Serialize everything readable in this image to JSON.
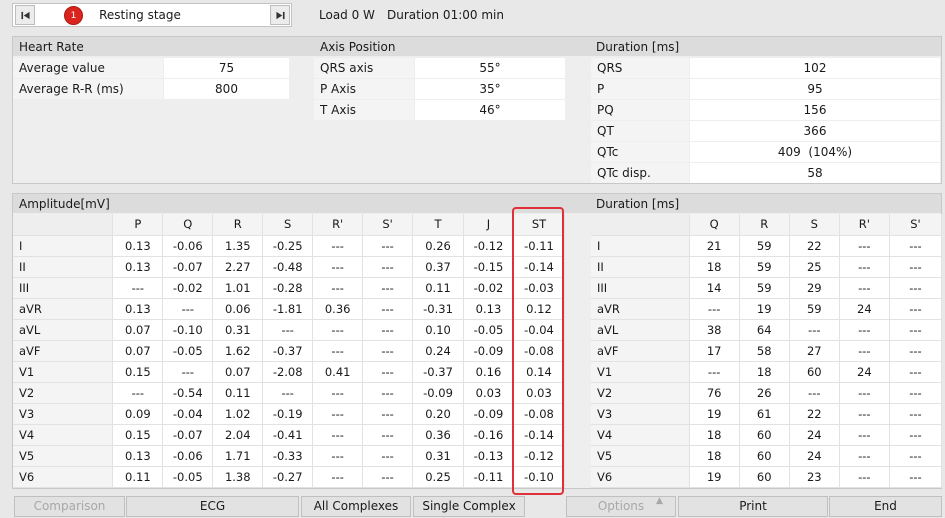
{
  "toolbar": {
    "stage_number": "1",
    "stage_name": "Resting stage",
    "load": "Load 0 W",
    "duration": "Duration 01:00 min"
  },
  "heart_rate": {
    "title": "Heart Rate",
    "rows": [
      {
        "label": "Average value",
        "value": "75"
      },
      {
        "label": "Average R-R (ms)",
        "value": "800"
      }
    ]
  },
  "axis_position": {
    "title": "Axis Position",
    "rows": [
      {
        "label": "QRS axis",
        "value": "55°"
      },
      {
        "label": "P Axis",
        "value": "35°"
      },
      {
        "label": "T Axis",
        "value": "46°"
      }
    ]
  },
  "duration_top": {
    "title": "Duration [ms]",
    "rows": [
      {
        "label": "QRS",
        "value": "102"
      },
      {
        "label": "P",
        "value": "95"
      },
      {
        "label": "PQ",
        "value": "156"
      },
      {
        "label": "QT",
        "value": "366"
      },
      {
        "label": "QTc",
        "value": "409  (104%)"
      },
      {
        "label": "QTc disp.",
        "value": "58"
      }
    ]
  },
  "amplitude": {
    "title": "Amplitude[mV]",
    "columns": [
      "P",
      "Q",
      "R",
      "S",
      "R'",
      "S'",
      "T",
      "J",
      "ST"
    ],
    "rows": [
      {
        "lead": "I",
        "values": [
          "0.13",
          "-0.06",
          "1.35",
          "-0.25",
          "---",
          "---",
          "0.26",
          "-0.12",
          "-0.11"
        ]
      },
      {
        "lead": "II",
        "values": [
          "0.13",
          "-0.07",
          "2.27",
          "-0.48",
          "---",
          "---",
          "0.37",
          "-0.15",
          "-0.14"
        ]
      },
      {
        "lead": "III",
        "values": [
          "---",
          "-0.02",
          "1.01",
          "-0.28",
          "---",
          "---",
          "0.11",
          "-0.02",
          "-0.03"
        ]
      },
      {
        "lead": "aVR",
        "values": [
          "0.13",
          "---",
          "0.06",
          "-1.81",
          "0.36",
          "---",
          "-0.31",
          "0.13",
          "0.12"
        ]
      },
      {
        "lead": "aVL",
        "values": [
          "0.07",
          "-0.10",
          "0.31",
          "---",
          "---",
          "---",
          "0.10",
          "-0.05",
          "-0.04"
        ]
      },
      {
        "lead": "aVF",
        "values": [
          "0.07",
          "-0.05",
          "1.62",
          "-0.37",
          "---",
          "---",
          "0.24",
          "-0.09",
          "-0.08"
        ]
      },
      {
        "lead": "V1",
        "values": [
          "0.15",
          "---",
          "0.07",
          "-2.08",
          "0.41",
          "---",
          "-0.37",
          "0.16",
          "0.14"
        ]
      },
      {
        "lead": "V2",
        "values": [
          "---",
          "-0.54",
          "0.11",
          "---",
          "---",
          "---",
          "-0.09",
          "0.03",
          "0.03"
        ]
      },
      {
        "lead": "V3",
        "values": [
          "0.09",
          "-0.04",
          "1.02",
          "-0.19",
          "---",
          "---",
          "0.20",
          "-0.09",
          "-0.08"
        ]
      },
      {
        "lead": "V4",
        "values": [
          "0.15",
          "-0.07",
          "2.04",
          "-0.41",
          "---",
          "---",
          "0.36",
          "-0.16",
          "-0.14"
        ]
      },
      {
        "lead": "V5",
        "values": [
          "0.13",
          "-0.06",
          "1.71",
          "-0.33",
          "---",
          "---",
          "0.31",
          "-0.13",
          "-0.12"
        ]
      },
      {
        "lead": "V6",
        "values": [
          "0.11",
          "-0.05",
          "1.38",
          "-0.27",
          "---",
          "---",
          "0.25",
          "-0.11",
          "-0.10"
        ]
      }
    ]
  },
  "duration_bottom": {
    "title": "Duration [ms]",
    "columns": [
      "Q",
      "R",
      "S",
      "R'",
      "S'"
    ],
    "rows": [
      {
        "lead": "I",
        "values": [
          "21",
          "59",
          "22",
          "---",
          "---"
        ]
      },
      {
        "lead": "II",
        "values": [
          "18",
          "59",
          "25",
          "---",
          "---"
        ]
      },
      {
        "lead": "III",
        "values": [
          "14",
          "59",
          "29",
          "---",
          "---"
        ]
      },
      {
        "lead": "aVR",
        "values": [
          "---",
          "19",
          "59",
          "24",
          "---"
        ]
      },
      {
        "lead": "aVL",
        "values": [
          "38",
          "64",
          "---",
          "---",
          "---"
        ]
      },
      {
        "lead": "aVF",
        "values": [
          "17",
          "58",
          "27",
          "---",
          "---"
        ]
      },
      {
        "lead": "V1",
        "values": [
          "---",
          "18",
          "60",
          "24",
          "---"
        ]
      },
      {
        "lead": "V2",
        "values": [
          "76",
          "26",
          "---",
          "---",
          "---"
        ]
      },
      {
        "lead": "V3",
        "values": [
          "19",
          "61",
          "22",
          "---",
          "---"
        ]
      },
      {
        "lead": "V4",
        "values": [
          "18",
          "60",
          "24",
          "---",
          "---"
        ]
      },
      {
        "lead": "V5",
        "values": [
          "18",
          "60",
          "24",
          "---",
          "---"
        ]
      },
      {
        "lead": "V6",
        "values": [
          "19",
          "60",
          "23",
          "---",
          "---"
        ]
      }
    ]
  },
  "buttons": {
    "comparison": "Comparison",
    "ecg": "ECG",
    "all_complexes": "All Complexes",
    "single_complex": "Single Complex",
    "options": "Options",
    "print": "Print",
    "end": "End"
  },
  "colors": {
    "highlight": "#e0303a",
    "stage_badge": "#d9251d"
  },
  "icons": {
    "first": "skip-first-icon",
    "last": "skip-last-icon",
    "options_caret": "caret-up-icon"
  }
}
